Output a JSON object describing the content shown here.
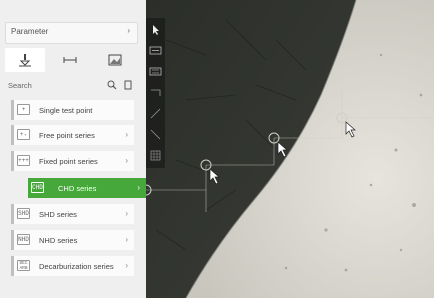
{
  "parameter": {
    "label": "Parameter",
    "chevron": "›"
  },
  "tabs": [
    {
      "icon": "indenter-icon",
      "active": true
    },
    {
      "icon": "distance-icon",
      "active": false
    },
    {
      "icon": "image-icon",
      "active": false
    }
  ],
  "search": {
    "placeholder": "Search",
    "search_icon": "search-icon",
    "copy_icon": "copy-icon"
  },
  "items": [
    {
      "icon_text": "+",
      "label": "Single test point",
      "chevron": ""
    },
    {
      "icon_text": "+₊",
      "label": "Free point series",
      "chevron": "›"
    },
    {
      "icon_text": "+++",
      "label": "Fixed point series",
      "chevron": "›"
    },
    {
      "icon_text": "CHD",
      "label": "CHD series",
      "chevron": "›",
      "selected": true
    },
    {
      "icon_text": "SHD",
      "label": "SHD series",
      "chevron": "›"
    },
    {
      "icon_text": "NHD",
      "label": "NHD series",
      "chevron": "›"
    },
    {
      "icon_text": "DEC\nARB",
      "label": "Decarburization series",
      "chevron": "›"
    }
  ],
  "toolbar": [
    "pointer-icon",
    "measure-icon",
    "scale-icon",
    "frame-icon",
    "line-icon",
    "diagonal-icon",
    "grid-icon"
  ],
  "colors": {
    "accent": "#46a73a",
    "panel": "#efefef"
  }
}
